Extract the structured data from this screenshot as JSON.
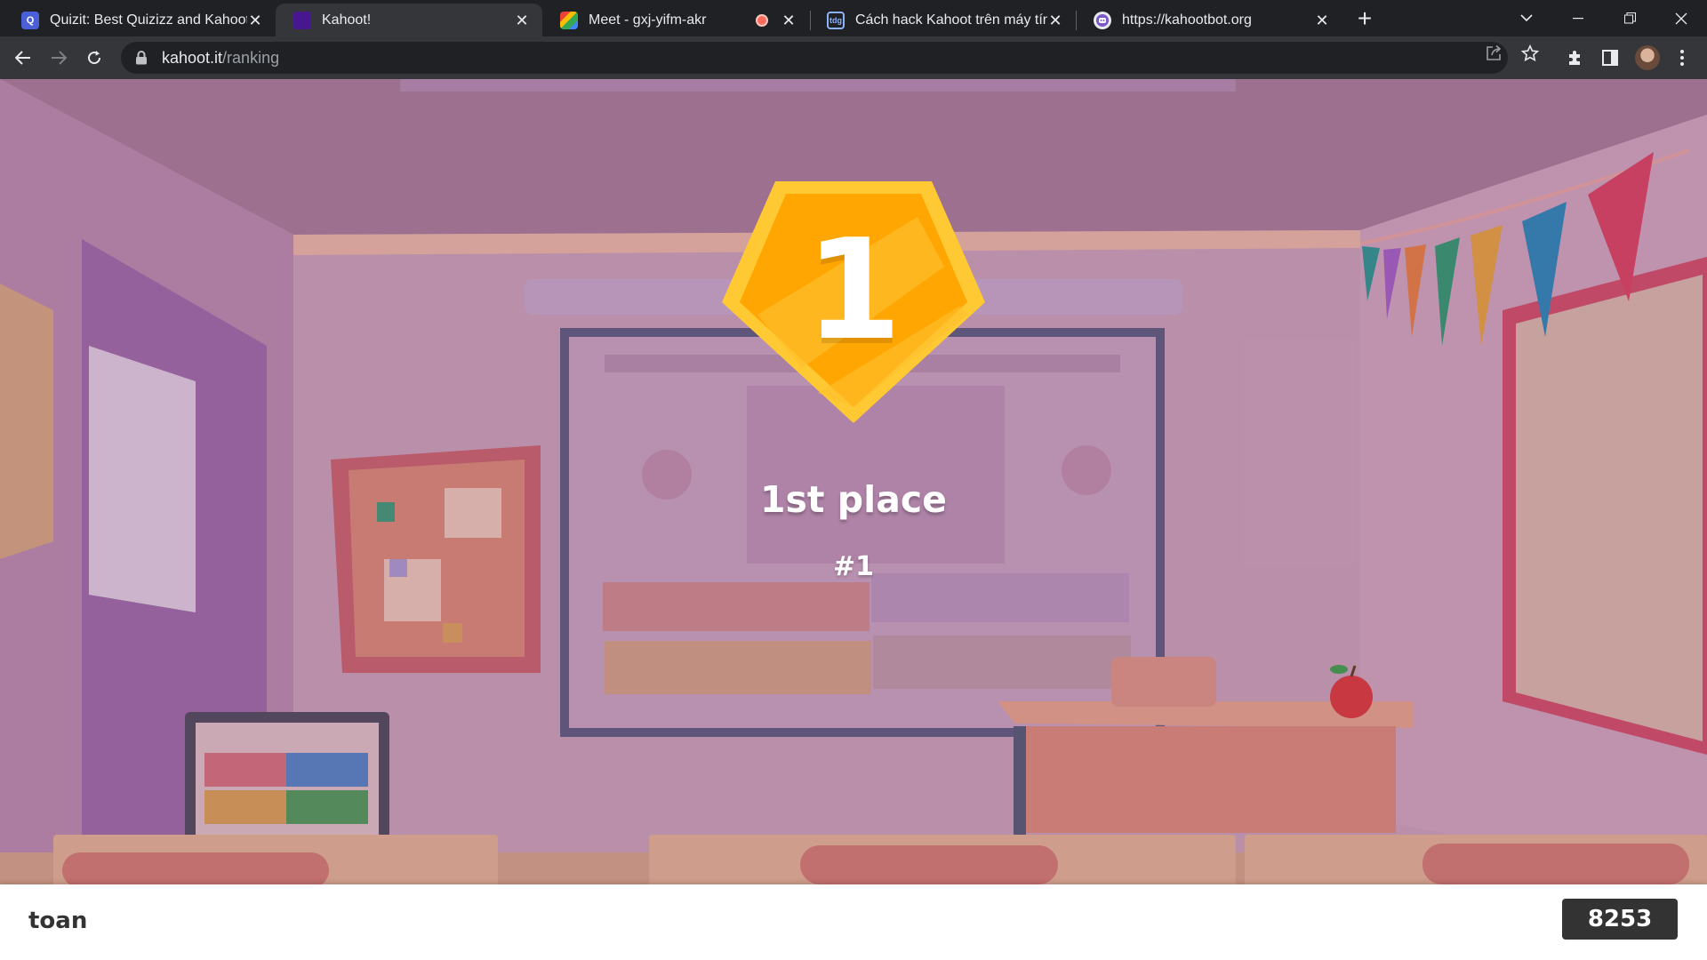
{
  "browser": {
    "tabs": [
      {
        "title": "Quizit: Best Quizizz and Kahoot C",
        "favicon": "quizit-favicon",
        "favicon_color": "#4a5fd8",
        "favicon_letter": "Q",
        "active": false
      },
      {
        "title": "Kahoot!",
        "favicon": "kahoot-favicon",
        "favicon_color": "#46178f",
        "favicon_letter": "",
        "active": true
      },
      {
        "title": "Meet - gxj-yifm-akr",
        "favicon": "meet-favicon",
        "favicon_color": "#00832d",
        "favicon_letter": "",
        "active": false,
        "recording": true
      },
      {
        "title": "Cách hack Kahoot trên máy tính,",
        "favicon": "tdg-favicon",
        "favicon_color": "#1a73e8",
        "favicon_letter": "tdg",
        "active": false
      },
      {
        "title": "https://kahootbot.org",
        "favicon": "kahootbot-favicon",
        "favicon_color": "#7b57c8",
        "favicon_letter": "",
        "active": false
      }
    ],
    "url_host": "kahoot.it",
    "url_path": "/ranking"
  },
  "ranking": {
    "badge_number": "1",
    "place_label": "1st place",
    "rank_label": "#1"
  },
  "player": {
    "nickname": "toan",
    "score": "8253"
  },
  "colors": {
    "badge_gold": "#ffa602",
    "badge_light": "#ffc933",
    "score_bg": "#333333"
  }
}
